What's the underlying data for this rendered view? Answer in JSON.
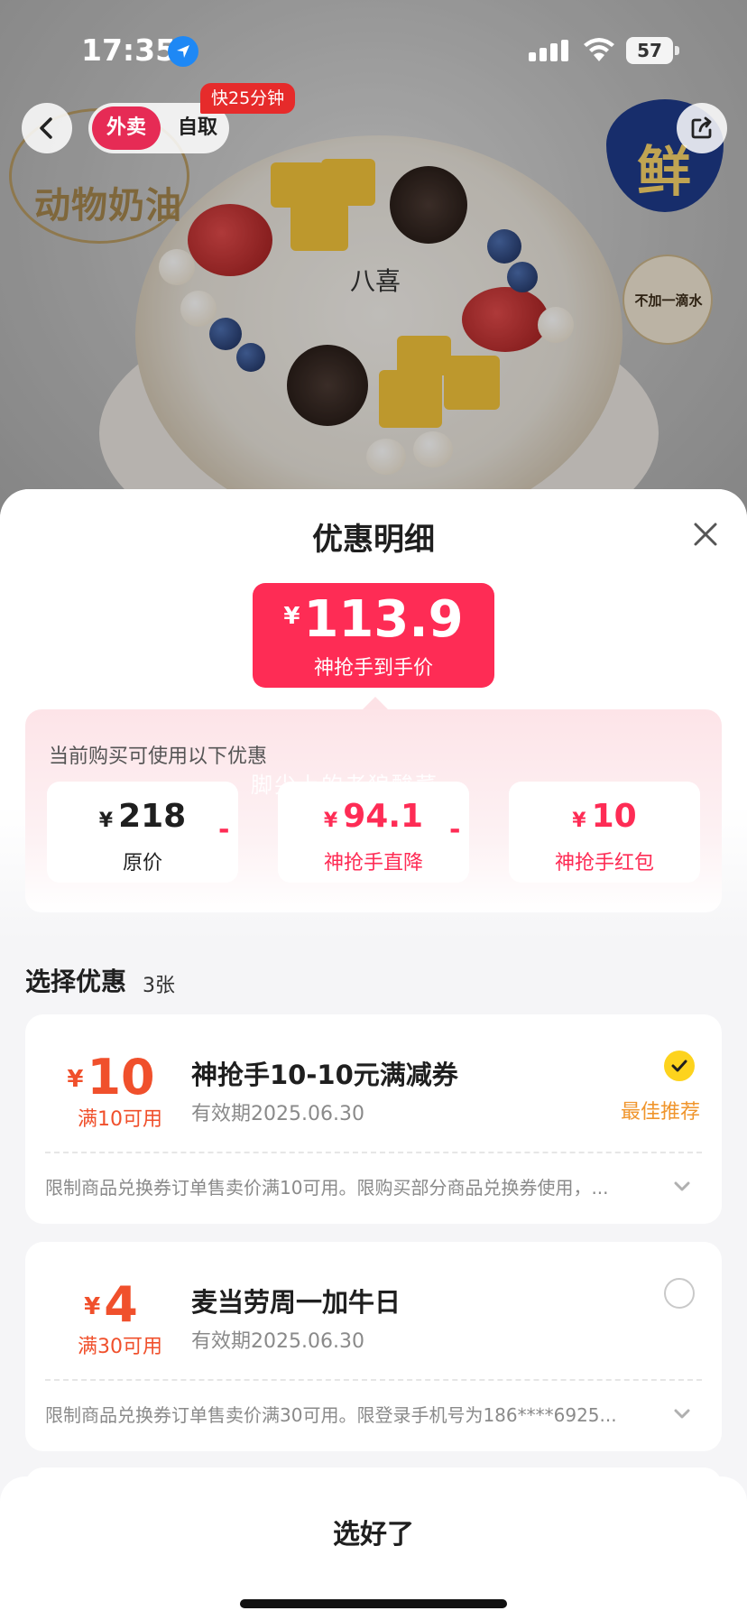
{
  "status_bar": {
    "time": "17:35",
    "battery": "57"
  },
  "hero": {
    "mode_active": "外卖",
    "mode_other": "自取",
    "fast_tag": "快25分钟",
    "badge_left_text": "动物奶油",
    "badge_fresh_char": "鲜",
    "badge_water_text": "不加一滴水",
    "brand_logo": "八喜"
  },
  "sheet": {
    "title": "优惠明细",
    "price": {
      "currency": "¥",
      "amount": "113.9",
      "label": "神抢手到手价"
    },
    "discount_label": "当前购买可使用以下优惠",
    "watermark": "脚尖上的老狼酸菜",
    "breakdown": [
      {
        "currency": "¥",
        "amount": "218",
        "label": "原价"
      },
      {
        "currency": "¥",
        "amount": "94.1",
        "label": "神抢手直降"
      },
      {
        "currency": "¥",
        "amount": "10",
        "label": "神抢手红包"
      }
    ],
    "operators": [
      "-",
      "-"
    ],
    "select_title": "选择优惠",
    "select_count": "3张",
    "coupons": [
      {
        "currency": "¥",
        "amount": "10",
        "condition": "满10可用",
        "name": "神抢手10-10元满减券",
        "validity": "有效期2025.06.30",
        "selected": true,
        "recommend": "最佳推荐",
        "description": "限制商品兑换券订单售卖价满10可用。限购买部分商品兑换券使用，..."
      },
      {
        "currency": "¥",
        "amount": "4",
        "condition": "满30可用",
        "name": "麦当劳周一加牛日",
        "validity": "有效期2025.06.30",
        "selected": false,
        "description": "限制商品兑换券订单售卖价满30可用。限登录手机号为186****6925..."
      }
    ],
    "confirm_button": "选好了"
  },
  "colors": {
    "accent": "#fe2c55",
    "coupon_orange": "#f0502c",
    "recommend": "#f0952c",
    "check": "#fdd31d"
  },
  "icons": [
    "location-icon",
    "signal-icon",
    "wifi-icon",
    "battery-icon",
    "back-icon",
    "share-icon",
    "close-icon",
    "check-icon",
    "chevron-down-icon"
  ]
}
